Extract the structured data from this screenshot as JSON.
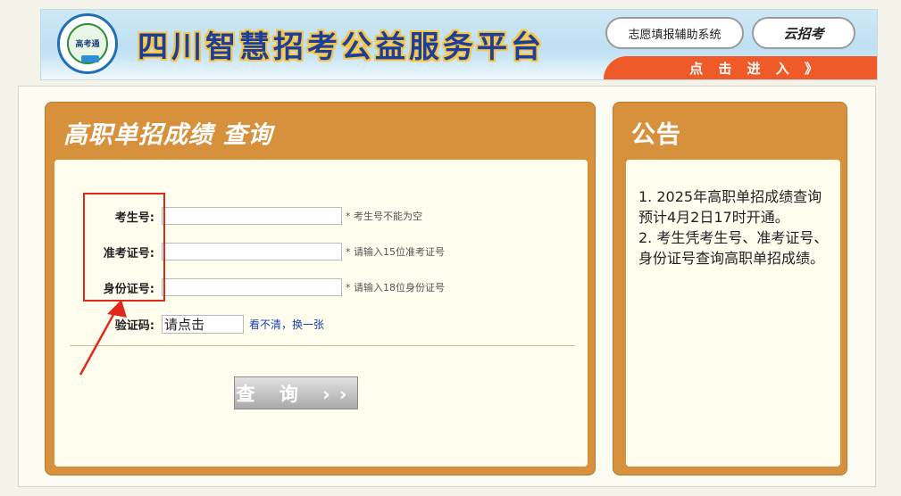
{
  "header": {
    "logo_text": "高考通",
    "title": "四川智慧招考公益服务平台",
    "volunteer_button": "志愿填报辅助系统",
    "brand_button": "云招考",
    "enter_label": "点 击 进 入 》"
  },
  "query_panel": {
    "title": "高职单招成绩 查询",
    "fields": [
      {
        "label": "考生号:",
        "hint": "* 考生号不能为空"
      },
      {
        "label": "准考证号:",
        "hint": "* 请输入15位准考证号"
      },
      {
        "label": "身份证号:",
        "hint": "* 请输入18位身份证号"
      }
    ],
    "captcha_label": "验证码:",
    "captcha_text": "请点击",
    "captcha_refresh": "看不清，换一张",
    "submit_label": "查 询 ››"
  },
  "notice_panel": {
    "title": "公告",
    "items": [
      "1. 2025年高职单招成绩查询预计4月2日17时开通。",
      "2. 考生凭考生号、准考证号、身份证号查询高职单招成绩。"
    ]
  },
  "colors": {
    "panel": "#d7913c",
    "panel_body": "#fffdee",
    "enter_bar": "#f05a28",
    "highlight_box": "#e0291b",
    "title_blue": "#1d3f9a"
  }
}
